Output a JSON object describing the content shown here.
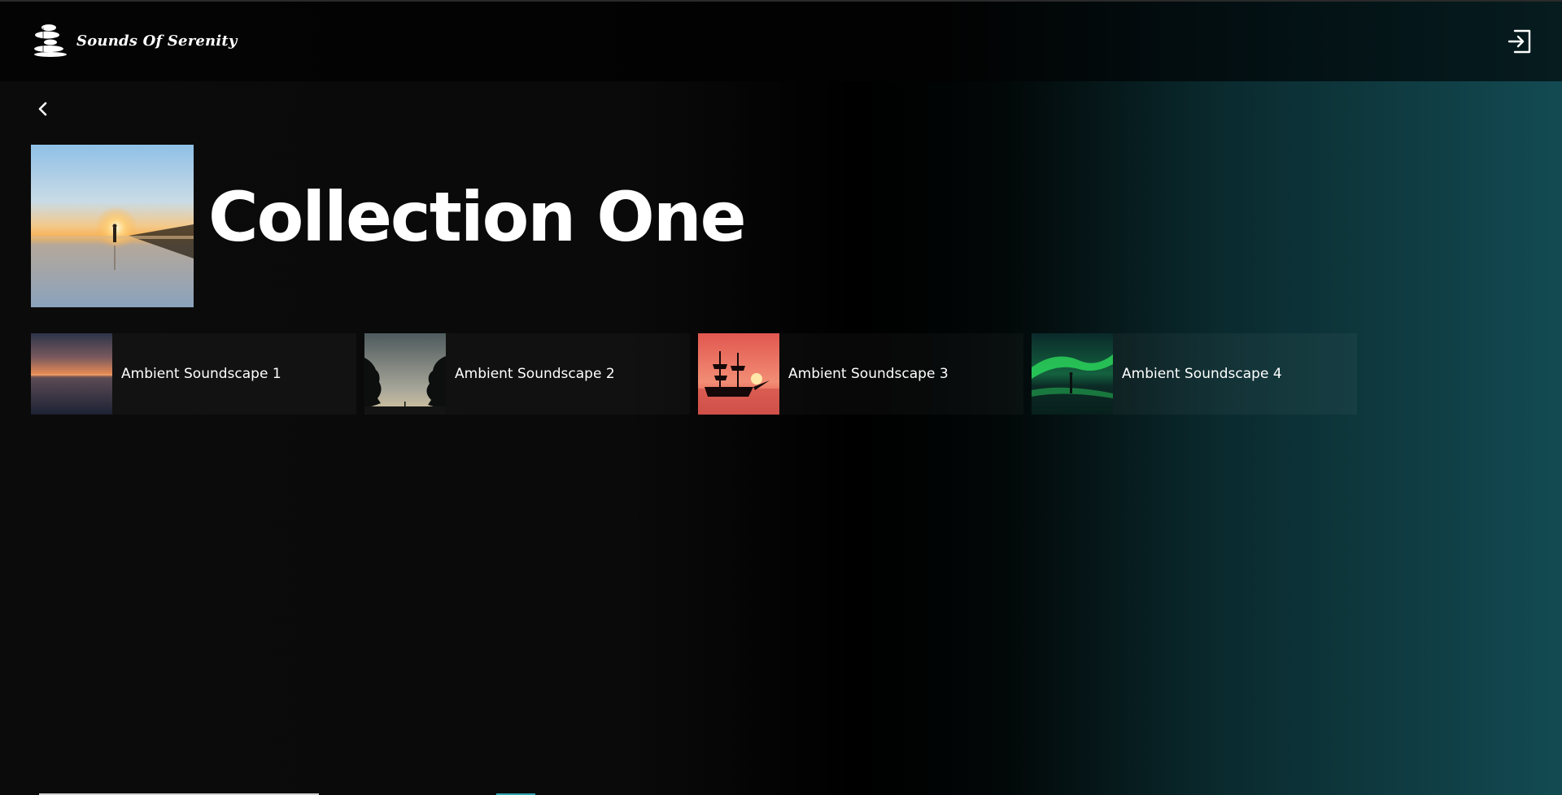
{
  "header": {
    "brand": "Sounds Of Serenity",
    "logo_icon": "stacked-stones-icon",
    "logout_icon": "logout-icon"
  },
  "nav": {
    "back_icon": "chevron-left-icon"
  },
  "collection": {
    "title": "Collection One",
    "cover_icon": "beach-sunset-image"
  },
  "tracks": [
    {
      "label": "Ambient Soundscape 1",
      "image": "sunset-sea-image"
    },
    {
      "label": "Ambient Soundscape 2",
      "image": "trees-dusk-image"
    },
    {
      "label": "Ambient Soundscape 3",
      "image": "ship-sunset-image"
    },
    {
      "label": "Ambient Soundscape 4",
      "image": "aurora-image"
    }
  ],
  "colors": {
    "background_dark": "#0b0b0b",
    "background_teal": "#134a52",
    "text": "#ffffff"
  }
}
